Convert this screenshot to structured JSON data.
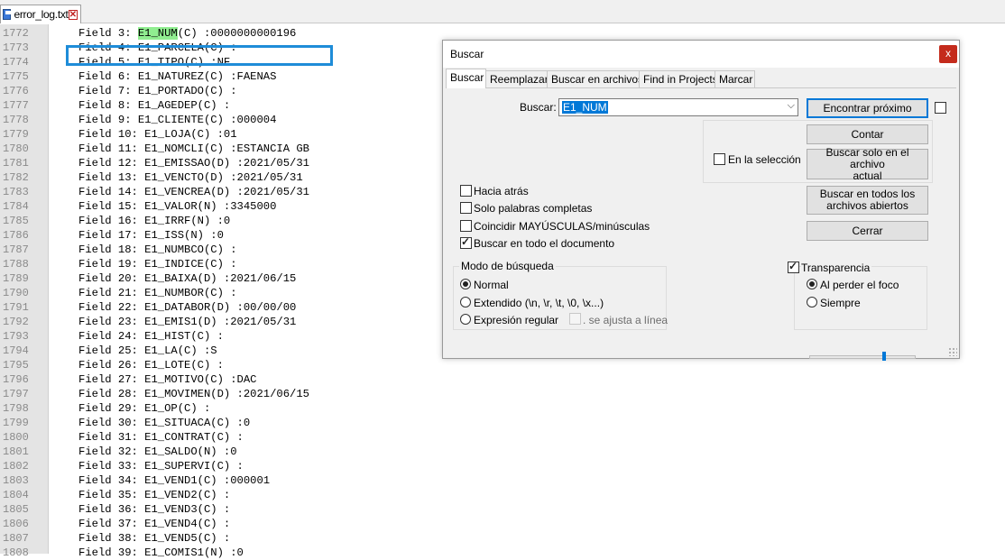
{
  "tab": {
    "filename": "error_log.txt",
    "close_glyph": "✕"
  },
  "editor": {
    "lines": [
      {
        "num": "1772",
        "pre": "Field 3: ",
        "hl": "E1_NUM",
        "post": "(C) :0000000000196"
      },
      {
        "num": "1773",
        "text": "Field 4: E1_PARCELA(C) :"
      },
      {
        "num": "1774",
        "text": "Field 5: E1_TIPO(C) :NF"
      },
      {
        "num": "1775",
        "text": "Field 6: E1_NATUREZ(C) :FAENAS"
      },
      {
        "num": "1776",
        "text": "Field 7: E1_PORTADO(C) :"
      },
      {
        "num": "1777",
        "text": "Field 8: E1_AGEDEP(C) :"
      },
      {
        "num": "1778",
        "text": "Field 9: E1_CLIENTE(C) :000004"
      },
      {
        "num": "1779",
        "text": "Field 10: E1_LOJA(C) :01"
      },
      {
        "num": "1780",
        "text": "Field 11: E1_NOMCLI(C) :ESTANCIA GB"
      },
      {
        "num": "1781",
        "text": "Field 12: E1_EMISSAO(D) :2021/05/31"
      },
      {
        "num": "1782",
        "text": "Field 13: E1_VENCTO(D) :2021/05/31"
      },
      {
        "num": "1783",
        "text": "Field 14: E1_VENCREA(D) :2021/05/31"
      },
      {
        "num": "1784",
        "text": "Field 15: E1_VALOR(N) :3345000"
      },
      {
        "num": "1785",
        "text": "Field 16: E1_IRRF(N) :0"
      },
      {
        "num": "1786",
        "text": "Field 17: E1_ISS(N) :0"
      },
      {
        "num": "1787",
        "text": "Field 18: E1_NUMBCO(C) :"
      },
      {
        "num": "1788",
        "text": "Field 19: E1_INDICE(C) :"
      },
      {
        "num": "1789",
        "text": "Field 20: E1_BAIXA(D) :2021/06/15"
      },
      {
        "num": "1790",
        "text": "Field 21: E1_NUMBOR(C) :"
      },
      {
        "num": "1791",
        "text": "Field 22: E1_DATABOR(D) :00/00/00"
      },
      {
        "num": "1792",
        "text": "Field 23: E1_EMIS1(D) :2021/05/31"
      },
      {
        "num": "1793",
        "text": "Field 24: E1_HIST(C) :"
      },
      {
        "num": "1794",
        "text": "Field 25: E1_LA(C) :S"
      },
      {
        "num": "1795",
        "text": "Field 26: E1_LOTE(C) :"
      },
      {
        "num": "1796",
        "text": "Field 27: E1_MOTIVO(C) :DAC"
      },
      {
        "num": "1797",
        "text": "Field 28: E1_MOVIMEN(D) :2021/06/15"
      },
      {
        "num": "1798",
        "text": "Field 29: E1_OP(C) :"
      },
      {
        "num": "1799",
        "text": "Field 30: E1_SITUACA(C) :0"
      },
      {
        "num": "1800",
        "text": "Field 31: E1_CONTRAT(C) :"
      },
      {
        "num": "1801",
        "text": "Field 32: E1_SALDO(N) :0"
      },
      {
        "num": "1802",
        "text": "Field 33: E1_SUPERVI(C) :"
      },
      {
        "num": "1803",
        "text": "Field 34: E1_VEND1(C) :000001"
      },
      {
        "num": "1804",
        "text": "Field 35: E1_VEND2(C) :"
      },
      {
        "num": "1805",
        "text": "Field 36: E1_VEND3(C) :"
      },
      {
        "num": "1806",
        "text": "Field 37: E1_VEND4(C) :"
      },
      {
        "num": "1807",
        "text": "Field 38: E1_VEND5(C) :"
      },
      {
        "num": "1808",
        "text": "Field 39: E1_COMIS1(N) :0"
      }
    ]
  },
  "dialog": {
    "title": "Buscar",
    "close_glyph": "x",
    "tabs": [
      "Buscar",
      "Reemplazar",
      "Buscar en archivos",
      "Find in Projects",
      "Marcar"
    ],
    "search_label": "Buscar:",
    "search_value": "E1_NUM",
    "combo_arrow": "⌵",
    "buttons": {
      "find_next": "Encontrar próximo",
      "count": "Contar",
      "find_current_1": "Buscar solo en el archivo",
      "find_current_2": "actual",
      "find_all_1": "Buscar en todos los",
      "find_all_2": "archivos abiertos",
      "close": "Cerrar"
    },
    "in_selection": "En la selección",
    "options": {
      "backward": "Hacia atrás",
      "whole_word": "Solo palabras completas",
      "match_case": "Coincidir MAYÚSCULAS/minúsculas",
      "wrap": "Buscar en todo el documento"
    },
    "search_mode": {
      "title": "Modo de búsqueda",
      "normal": "Normal",
      "extended": "Extendido (\\n, \\r, \\t, \\0, \\x...)",
      "regex": "Expresión regular",
      "dot_newline": ". se ajusta a línea"
    },
    "transparency": {
      "title": "Transparencia",
      "on_lose_focus": "Al perder el foco",
      "always": "Siempre",
      "level": 0.7
    }
  }
}
